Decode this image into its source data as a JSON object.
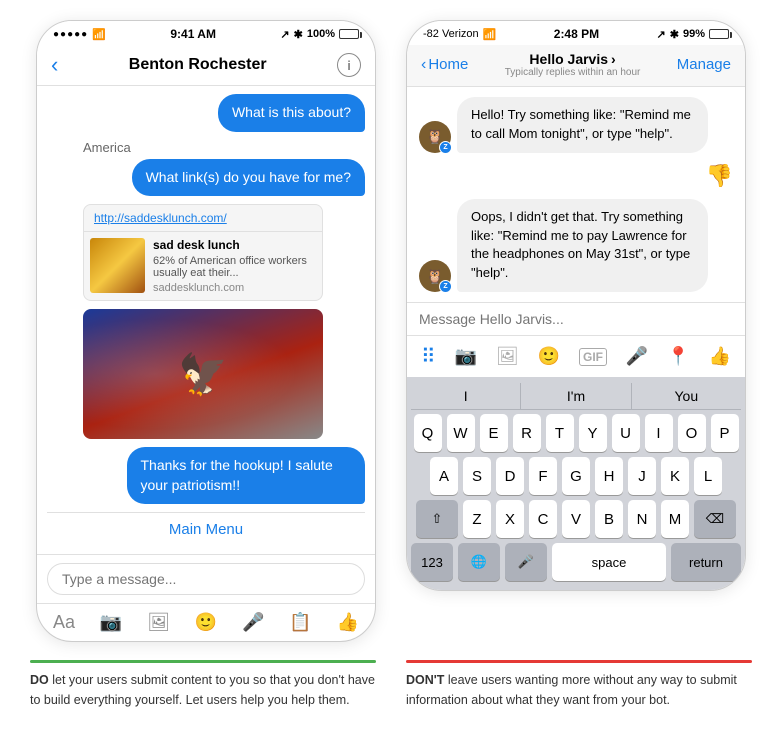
{
  "left_phone": {
    "status": {
      "time": "9:41 AM",
      "signal": "●●●●●",
      "wifi": "WiFi",
      "arrow": "↗",
      "bluetooth": "✱",
      "battery": "100%"
    },
    "header": {
      "back_label": "‹",
      "title": "Benton Rochester",
      "info_label": "i"
    },
    "messages": [
      {
        "type": "out",
        "text": "What is this about?"
      },
      {
        "sender": "America",
        "type": "in-label"
      },
      {
        "type": "out",
        "text": "What link(s) do you have for me?"
      },
      {
        "type": "link-preview",
        "url": "http://saddesklunch.com/",
        "title": "sad desk lunch",
        "desc": "62% of American office workers usually eat their...",
        "domain": "saddesklunch.com"
      },
      {
        "type": "image"
      },
      {
        "type": "out",
        "text": "Thanks for the hookup! I salute your patriotism!!"
      }
    ],
    "main_menu_label": "Main Menu",
    "input_placeholder": "Type a message...",
    "toolbar_icons": [
      "Aa",
      "📷",
      "📁",
      "😊",
      "🎤",
      "📋",
      "👍"
    ]
  },
  "right_phone": {
    "status": {
      "carrier": "-82 Verizon",
      "time": "2:48 PM",
      "arrow": "↗",
      "bluetooth": "✱",
      "battery": "99%"
    },
    "header": {
      "back_label": "Home",
      "name": "Hello Jarvis",
      "chevron": "›",
      "sub": "Typically replies within an hour",
      "manage_label": "Manage"
    },
    "messages": [
      {
        "type": "in",
        "text": "Hello! Try something like: \"Remind me to call Mom tonight\", or type \"help\"."
      },
      {
        "type": "thumbsdown"
      },
      {
        "type": "in",
        "text": "Oops, I didn't get that. Try something like: \"Remind me to pay Lawrence for the headphones on May 31st\", or type \"help\"."
      }
    ],
    "input_placeholder": "Message Hello Jarvis...",
    "toolbar_icons": [
      "⠿",
      "📷",
      "📸",
      "😊",
      "GIF",
      "🎤",
      "📍",
      "👍"
    ],
    "keyboard": {
      "suggestions": [
        "I",
        "I'm",
        "You"
      ],
      "rows": [
        [
          "Q",
          "W",
          "E",
          "R",
          "T",
          "Y",
          "U",
          "I",
          "O",
          "P"
        ],
        [
          "A",
          "S",
          "D",
          "F",
          "G",
          "H",
          "J",
          "K",
          "L"
        ],
        [
          "⇧",
          "Z",
          "X",
          "C",
          "V",
          "B",
          "N",
          "M",
          "⌫"
        ],
        [
          "123",
          "🌐",
          "🎤",
          "space",
          "return"
        ]
      ]
    }
  },
  "captions": {
    "do": {
      "type": "do",
      "label": "DO",
      "text": "let your users submit content to you so that you don't have to build everything yourself. Let users help you help them."
    },
    "dont": {
      "type": "dont",
      "label": "DON'T",
      "text": "leave users wanting more without any way to submit information about what they want from your bot."
    }
  }
}
